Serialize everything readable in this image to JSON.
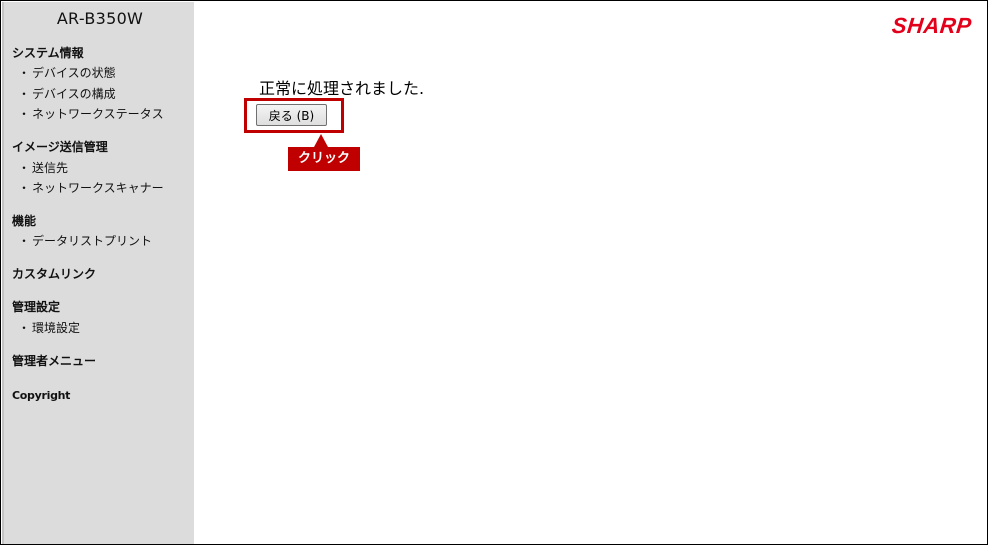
{
  "sidebar": {
    "model": "AR-B350W",
    "sections": [
      {
        "title": "システム情報",
        "items": [
          "デバイスの状態",
          "デバイスの構成",
          "ネットワークステータス"
        ]
      },
      {
        "title": "イメージ送信管理",
        "items": [
          "送信先",
          "ネットワークスキャナー"
        ]
      },
      {
        "title": "機能",
        "items": [
          "データリストプリント"
        ]
      },
      {
        "title": "カスタムリンク",
        "items": []
      },
      {
        "title": "管理設定",
        "items": [
          "環境設定"
        ]
      },
      {
        "title": "管理者メニュー",
        "items": []
      }
    ],
    "bullet": "・",
    "copyright": "Copyright"
  },
  "header": {
    "logo": "SHARP",
    "logo_color": "#e2001a"
  },
  "main": {
    "message": "正常に処理されました.",
    "back_button_label": "戻る (B)"
  },
  "annotation": {
    "callout_label": "クリック",
    "color": "#c00000"
  }
}
